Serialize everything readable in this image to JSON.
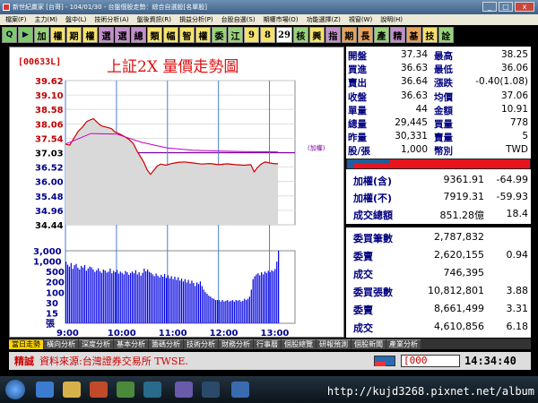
{
  "window": {
    "title": "新世紀贏家 [台哥] - 104/01/30 - 台盤個股走勢：綜合自選股[名單股]",
    "controls": [
      "_",
      "□",
      "x"
    ]
  },
  "menu": {
    "items": [
      "檔案(F)",
      "主力(M)",
      "盤中(L)",
      "技術分析(A)",
      "盤後資訊(R)",
      "損益分析(P)",
      "台股自選(S)",
      "期權市場(O)",
      "功能選擇(Z)",
      "視窗(W)",
      "說明(H)"
    ],
    "right": "功能選擇 視窗 說明"
  },
  "toolbar": {
    "buttons": [
      "Q",
      "▶",
      "加",
      "權",
      "期",
      "權",
      "選",
      "選",
      "總",
      "類",
      "幅",
      "智",
      "權",
      "委",
      "江",
      "9",
      "8",
      "29",
      "核",
      "興",
      "指",
      "期",
      "長",
      "產",
      "精",
      "基",
      "技",
      "詮"
    ]
  },
  "chart": {
    "code": "[00633L]",
    "title": "上証2X  量價走勢圖",
    "ref_label": "(加權)"
  },
  "chart_data": {
    "type": "line",
    "title": "上証2X  量價走勢圖",
    "x_ticks": [
      "9:00",
      "10:00",
      "11:00",
      "12:00",
      "13:00"
    ],
    "x_range": [
      0,
      270
    ],
    "price_ticks": [
      "39.62",
      "39.10",
      "38.58",
      "38.06",
      "37.54",
      "37.03",
      "36.52",
      "36.00",
      "35.48",
      "34.96",
      "34.44"
    ],
    "price_range": [
      34.44,
      39.62
    ],
    "reference": 37.03,
    "volume_ticks": [
      "3,000",
      "1,000",
      "500",
      "200",
      "100",
      "30",
      "15",
      "張"
    ],
    "series": [
      {
        "name": "上証2X",
        "points": [
          [
            0,
            37.34
          ],
          [
            5,
            37.3
          ],
          [
            10,
            37.55
          ],
          [
            15,
            37.8
          ],
          [
            20,
            37.95
          ],
          [
            25,
            38.15
          ],
          [
            30,
            38.22
          ],
          [
            33,
            38.25
          ],
          [
            38,
            38.1
          ],
          [
            42,
            38.0
          ],
          [
            48,
            37.95
          ],
          [
            54,
            37.9
          ],
          [
            58,
            37.78
          ],
          [
            64,
            37.7
          ],
          [
            70,
            37.6
          ],
          [
            75,
            37.5
          ],
          [
            80,
            37.35
          ],
          [
            84,
            37.1
          ],
          [
            88,
            36.9
          ],
          [
            92,
            36.7
          ],
          [
            96,
            36.42
          ],
          [
            100,
            36.25
          ],
          [
            104,
            36.4
          ],
          [
            108,
            36.55
          ],
          [
            112,
            36.62
          ],
          [
            118,
            36.58
          ],
          [
            125,
            36.64
          ],
          [
            132,
            36.68
          ],
          [
            140,
            36.7
          ],
          [
            150,
            36.66
          ],
          [
            160,
            36.62
          ],
          [
            170,
            36.64
          ],
          [
            180,
            36.6
          ],
          [
            190,
            36.63
          ],
          [
            200,
            36.6
          ],
          [
            210,
            36.58
          ],
          [
            218,
            36.6
          ],
          [
            222,
            36.34
          ],
          [
            226,
            36.5
          ],
          [
            230,
            36.62
          ],
          [
            235,
            36.7
          ],
          [
            240,
            36.66
          ],
          [
            245,
            36.64
          ],
          [
            250,
            36.63
          ]
        ]
      },
      {
        "name": "均價",
        "points": [
          [
            0,
            37.34
          ],
          [
            30,
            37.72
          ],
          [
            60,
            37.7
          ],
          [
            90,
            37.4
          ],
          [
            120,
            37.2
          ],
          [
            150,
            37.12
          ],
          [
            180,
            37.09
          ],
          [
            210,
            37.07
          ],
          [
            250,
            37.06
          ]
        ]
      }
    ],
    "volume": [
      [
        0,
        900
      ],
      [
        2,
        640
      ],
      [
        4,
        520
      ],
      [
        6,
        780
      ],
      [
        8,
        410
      ],
      [
        10,
        610
      ],
      [
        12,
        700
      ],
      [
        14,
        460
      ],
      [
        16,
        380
      ],
      [
        18,
        560
      ],
      [
        20,
        470
      ],
      [
        22,
        620
      ],
      [
        24,
        330
      ],
      [
        26,
        420
      ],
      [
        28,
        520
      ],
      [
        30,
        480
      ],
      [
        32,
        380
      ],
      [
        34,
        290
      ],
      [
        36,
        350
      ],
      [
        38,
        430
      ],
      [
        40,
        310
      ],
      [
        42,
        260
      ],
      [
        44,
        380
      ],
      [
        46,
        340
      ],
      [
        48,
        270
      ],
      [
        50,
        300
      ],
      [
        52,
        420
      ],
      [
        54,
        250
      ],
      [
        56,
        330
      ],
      [
        58,
        280
      ],
      [
        60,
        360
      ],
      [
        62,
        240
      ],
      [
        64,
        300
      ],
      [
        66,
        260
      ],
      [
        68,
        220
      ],
      [
        70,
        320
      ],
      [
        72,
        280
      ],
      [
        74,
        210
      ],
      [
        76,
        260
      ],
      [
        78,
        300
      ],
      [
        80,
        250
      ],
      [
        82,
        350
      ],
      [
        84,
        220
      ],
      [
        86,
        280
      ],
      [
        88,
        190
      ],
      [
        90,
        260
      ],
      [
        92,
        420
      ],
      [
        94,
        310
      ],
      [
        96,
        380
      ],
      [
        98,
        290
      ],
      [
        100,
        260
      ],
      [
        102,
        220
      ],
      [
        104,
        180
      ],
      [
        106,
        240
      ],
      [
        108,
        190
      ],
      [
        110,
        160
      ],
      [
        112,
        210
      ],
      [
        114,
        170
      ],
      [
        116,
        230
      ],
      [
        118,
        150
      ],
      [
        120,
        200
      ],
      [
        122,
        140
      ],
      [
        124,
        180
      ],
      [
        126,
        130
      ],
      [
        128,
        170
      ],
      [
        130,
        120
      ],
      [
        132,
        160
      ],
      [
        134,
        110
      ],
      [
        136,
        140
      ],
      [
        138,
        100
      ],
      [
        140,
        130
      ],
      [
        142,
        90
      ],
      [
        144,
        120
      ],
      [
        146,
        80
      ],
      [
        148,
        110
      ],
      [
        150,
        85
      ],
      [
        152,
        60
      ],
      [
        154,
        90
      ],
      [
        156,
        75
      ],
      [
        158,
        100
      ],
      [
        160,
        60
      ],
      [
        162,
        40
      ],
      [
        164,
        30
      ],
      [
        166,
        25
      ],
      [
        168,
        20
      ],
      [
        170,
        18
      ],
      [
        172,
        15
      ],
      [
        174,
        14
      ],
      [
        176,
        12
      ],
      [
        178,
        12
      ],
      [
        180,
        12
      ],
      [
        182,
        10
      ],
      [
        184,
        12
      ],
      [
        186,
        10
      ],
      [
        188,
        11
      ],
      [
        190,
        12
      ],
      [
        192,
        10
      ],
      [
        194,
        11
      ],
      [
        196,
        12
      ],
      [
        198,
        10
      ],
      [
        200,
        12
      ],
      [
        202,
        11
      ],
      [
        204,
        12
      ],
      [
        206,
        10
      ],
      [
        208,
        11
      ],
      [
        210,
        14
      ],
      [
        212,
        12
      ],
      [
        214,
        14
      ],
      [
        216,
        18
      ],
      [
        218,
        40
      ],
      [
        220,
        130
      ],
      [
        222,
        180
      ],
      [
        224,
        220
      ],
      [
        226,
        250
      ],
      [
        228,
        200
      ],
      [
        230,
        280
      ],
      [
        232,
        220
      ],
      [
        234,
        300
      ],
      [
        236,
        260
      ],
      [
        238,
        330
      ],
      [
        240,
        280
      ],
      [
        242,
        350
      ],
      [
        244,
        310
      ],
      [
        246,
        400
      ],
      [
        248,
        900
      ],
      [
        250,
        3000
      ]
    ],
    "grid": true
  },
  "quote": {
    "rows": [
      [
        "開盤",
        "37.34",
        "最高",
        "38.25"
      ],
      [
        "買進",
        "36.63",
        "最低",
        "36.06"
      ],
      [
        "賣出",
        "36.64",
        "漲跌",
        "-0.40(1.08)"
      ],
      [
        "收盤",
        "36.63",
        "均價",
        "37.06"
      ],
      [
        "單量",
        "44",
        "金額",
        "10.91"
      ],
      [
        "總量",
        "29,445",
        "買量",
        "778"
      ],
      [
        "昨量",
        "30,331",
        "賣量",
        "5"
      ],
      [
        "股/張",
        "1,000",
        "幣別",
        "TWD"
      ]
    ]
  },
  "index": {
    "rows": [
      [
        "加權(含)",
        "9361.91",
        "-64.99"
      ],
      [
        "加權(不)",
        "7919.31",
        "-59.93"
      ],
      [
        "成交總額",
        "851.28億",
        "18.4"
      ]
    ]
  },
  "orders": {
    "rows": [
      [
        "委買筆數",
        "2,787,832",
        ""
      ],
      [
        "委賣",
        "2,620,155",
        "0.94"
      ],
      [
        "成交",
        "746,395",
        ""
      ],
      [
        "委買張數",
        "10,812,801",
        "3.88"
      ],
      [
        "委賣",
        "8,661,499",
        "3.31"
      ],
      [
        "成交",
        "4,610,856",
        "6.18"
      ]
    ]
  },
  "tabs": [
    "當日走勢",
    "橫向分析",
    "深度分析",
    "基本分析",
    "籌碼分析",
    "技術分析",
    "財務分析",
    "行事曆",
    "個股總覽",
    "研報預測",
    "個股新聞",
    "產業分析"
  ],
  "ticker": {
    "brand": "精誠",
    "source": "資料來源:台灣證券交易所 TWSE.",
    "number": "[000",
    "clock": "14:34:40"
  },
  "footer": {
    "url": "http://kujd3268.pixnet.net/album"
  }
}
